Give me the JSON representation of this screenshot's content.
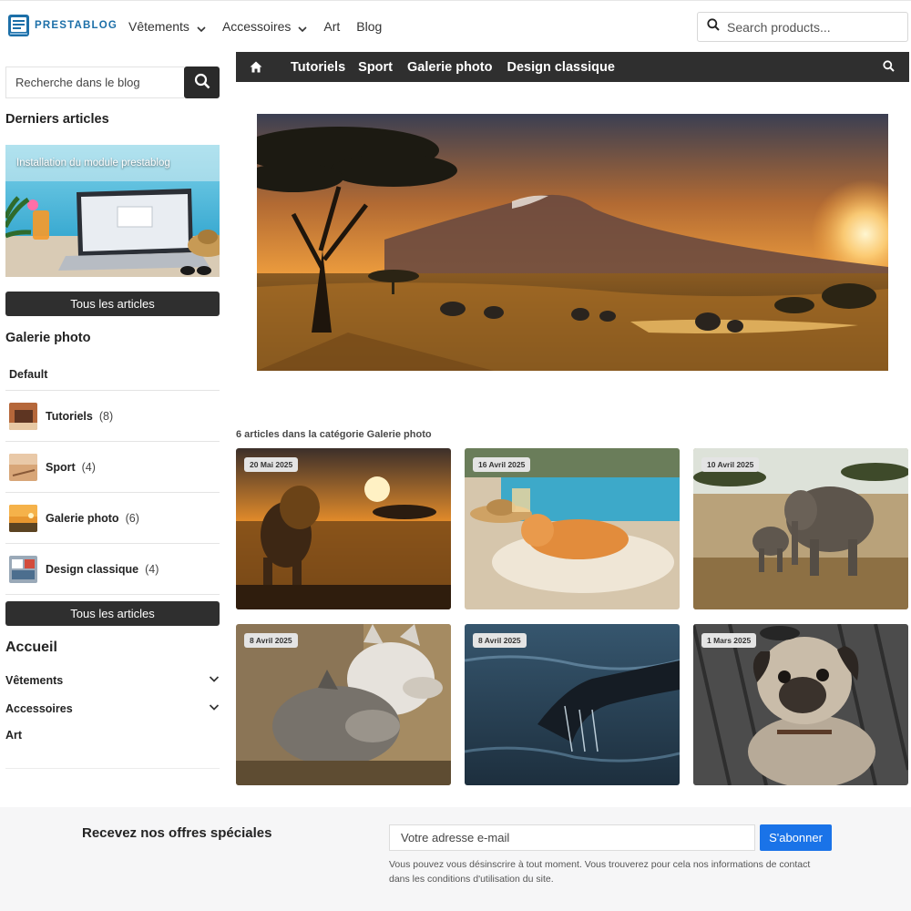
{
  "header": {
    "logo_text": "PRESTABLOG",
    "nav": [
      {
        "label": "Vêtements",
        "dropdown": true
      },
      {
        "label": "Accessoires",
        "dropdown": true
      },
      {
        "label": "Art",
        "dropdown": false
      },
      {
        "label": "Blog",
        "dropdown": false
      }
    ],
    "search_placeholder": "Search products..."
  },
  "sidebar": {
    "blog_search_placeholder": "Recherche dans le blog",
    "latest_title": "Derniers articles",
    "featured_caption": "Installation du module prestablog",
    "all_articles_label": "Tous les articles",
    "gallery_title": "Galerie photo",
    "default_label": "Default",
    "categories": [
      {
        "name": "Tutoriels",
        "count": "(8)"
      },
      {
        "name": "Sport",
        "count": "(4)"
      },
      {
        "name": "Galerie photo",
        "count": "(6)"
      },
      {
        "name": "Design classique",
        "count": "(4)"
      }
    ],
    "all_articles_label_2": "Tous les articles",
    "menu_title": "Accueil",
    "menu": [
      {
        "label": "Vêtements",
        "expandable": true
      },
      {
        "label": "Accessoires",
        "expandable": true
      },
      {
        "label": "Art",
        "expandable": false
      }
    ]
  },
  "blog_nav": [
    "Tutoriels",
    "Sport",
    "Galerie photo",
    "Design classique"
  ],
  "main": {
    "count_text": "6 articles dans la catégorie Galerie photo",
    "articles": [
      {
        "date": "20 Mai 2025",
        "subject": "lion-sunset"
      },
      {
        "date": "16 Avril 2025",
        "subject": "cat-pool"
      },
      {
        "date": "10 Avril 2025",
        "subject": "elephants"
      },
      {
        "date": "8 Avril 2025",
        "subject": "wolves"
      },
      {
        "date": "8 Avril 2025",
        "subject": "whale-tail"
      },
      {
        "date": "1 Mars 2025",
        "subject": "pug"
      }
    ]
  },
  "newsletter": {
    "title": "Recevez nos offres spéciales",
    "email_placeholder": "Votre adresse e-mail",
    "subscribe_label": "S'abonner",
    "note": "Vous pouvez vous désinscrire à tout moment. Vous trouverez pour cela nos informations de contact dans les conditions d'utilisation du site."
  },
  "colors": {
    "dark_bar": "#2f2f2f",
    "accent_blue": "#1a73e8",
    "logo_blue": "#1c6fa8"
  }
}
